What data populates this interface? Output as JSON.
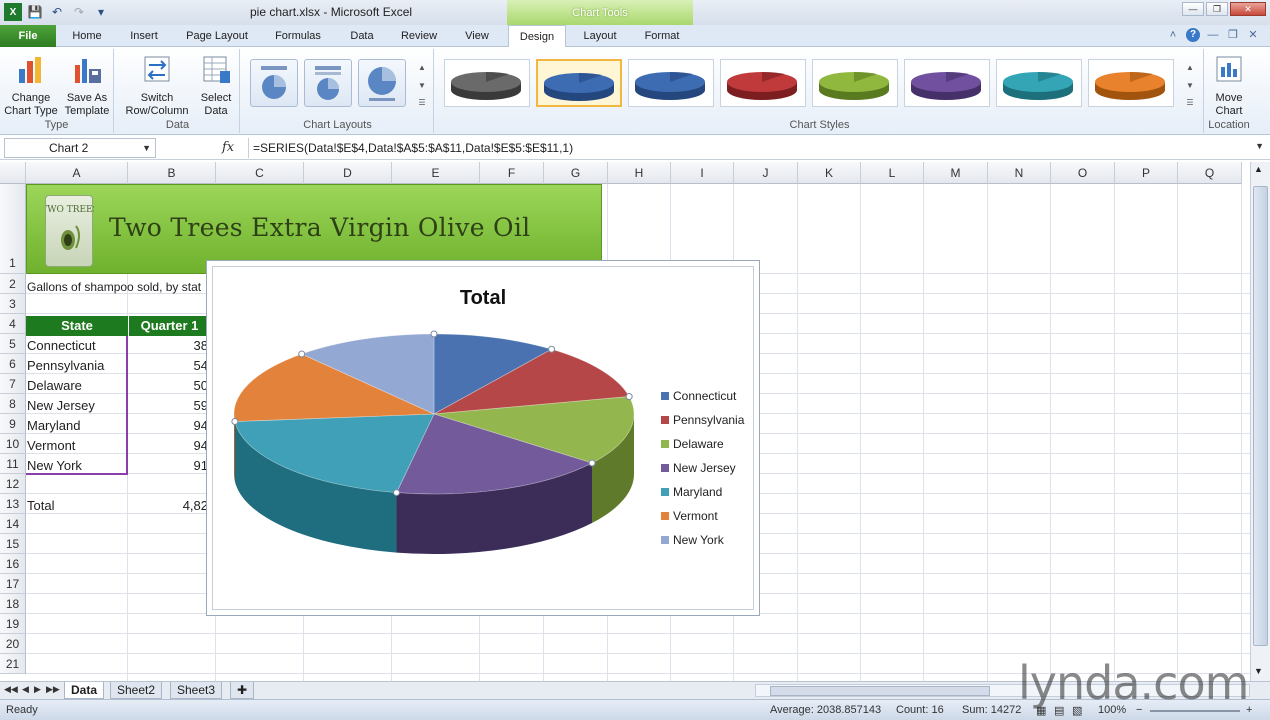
{
  "window": {
    "title": "pie chart.xlsx - Microsoft Excel",
    "contextual_header": "Chart Tools"
  },
  "qat": {
    "icons": [
      "save-icon",
      "undo-icon",
      "redo-icon",
      "customize-icon"
    ]
  },
  "tabs": [
    {
      "label": "File"
    },
    {
      "label": "Home"
    },
    {
      "label": "Insert"
    },
    {
      "label": "Page Layout"
    },
    {
      "label": "Formulas"
    },
    {
      "label": "Data"
    },
    {
      "label": "Review"
    },
    {
      "label": "View"
    },
    {
      "label": "Design"
    },
    {
      "label": "Layout"
    },
    {
      "label": "Format"
    }
  ],
  "ribbon": {
    "groups": {
      "type": "Type",
      "data": "Data",
      "chart_layouts": "Chart Layouts",
      "chart_styles": "Chart Styles",
      "location": "Location"
    },
    "buttons": {
      "change_chart_type": [
        "Change",
        "Chart Type"
      ],
      "save_as_template": [
        "Save As",
        "Template"
      ],
      "switch_row_column": [
        "Switch",
        "Row/Column"
      ],
      "select_data": [
        "Select",
        "Data"
      ],
      "move_chart": [
        "Move",
        "Chart"
      ]
    },
    "chart_styles": [
      {
        "top": "#6a6a6a",
        "side": "#3a3a3a"
      },
      {
        "top": "#3d6cb3",
        "side": "#24477e",
        "selected": true
      },
      {
        "top": "#3d6cb3",
        "side": "#24477e"
      },
      {
        "top": "#c0393b",
        "side": "#7c1e20"
      },
      {
        "top": "#90b83e",
        "side": "#5a7a20"
      },
      {
        "top": "#7150a0",
        "side": "#45306a"
      },
      {
        "top": "#33a5b5",
        "side": "#1d6f7b"
      },
      {
        "top": "#e8822c",
        "side": "#a2540f"
      }
    ]
  },
  "formula_bar": {
    "name_box": "Chart 2",
    "fx": "fx",
    "formula": "=SERIES(Data!$E$4,Data!$A$5:$A$11,Data!$E$5:$E$11,1)"
  },
  "columns": [
    "A",
    "B",
    "C",
    "D",
    "E",
    "F",
    "G",
    "H",
    "I",
    "J",
    "K",
    "L",
    "M",
    "N",
    "O",
    "P",
    "Q"
  ],
  "rows": [
    "1",
    "2",
    "3",
    "4",
    "5",
    "6",
    "7",
    "8",
    "9",
    "10",
    "11",
    "12",
    "13",
    "14",
    "15",
    "16",
    "17",
    "18",
    "19",
    "20",
    "21"
  ],
  "sheet": {
    "banner_title": "Two Trees Extra Virgin Olive Oil",
    "logo_text": "TWO TREES",
    "subtitle": "Gallons of shampoo sold, by stat",
    "header_state": "State",
    "header_q1": "Quarter 1",
    "data_rows": [
      {
        "state": "Connecticut",
        "q1": "38"
      },
      {
        "state": "Pennsylvania",
        "q1": "54"
      },
      {
        "state": "Delaware",
        "q1": "50"
      },
      {
        "state": "New Jersey",
        "q1": "59"
      },
      {
        "state": "Maryland",
        "q1": "94"
      },
      {
        "state": "Vermont",
        "q1": "94"
      },
      {
        "state": "New York",
        "q1": "91"
      }
    ],
    "total_label": "Total",
    "total_value": "4,82"
  },
  "chart_data": {
    "type": "pie",
    "title": "Total",
    "three_d": true,
    "legend_position": "right",
    "categories": [
      "Connecticut",
      "Pennsylvania",
      "Delaware",
      "New Jersey",
      "Maryland",
      "Vermont",
      "New York"
    ],
    "values": [
      10.0,
      11.5,
      14.0,
      17.5,
      20.5,
      15.0,
      11.5
    ],
    "colors": [
      "#4a72b0",
      "#b54748",
      "#94b64e",
      "#735a9a",
      "#3fa0b7",
      "#e3823a",
      "#93a9d4"
    ],
    "side_colors": [
      "#2d4a78",
      "#7a2a2b",
      "#5f7a2a",
      "#3c2c58",
      "#1f6e80",
      "#a65214",
      "#5c6f96"
    ]
  },
  "sheet_tabs": [
    "Data",
    "Sheet2",
    "Sheet3"
  ],
  "status": {
    "ready": "Ready",
    "average": "Average: 2038.857143",
    "count": "Count: 16",
    "sum": "Sum: 14272",
    "zoom": "100%"
  },
  "watermark": "lynda.com"
}
